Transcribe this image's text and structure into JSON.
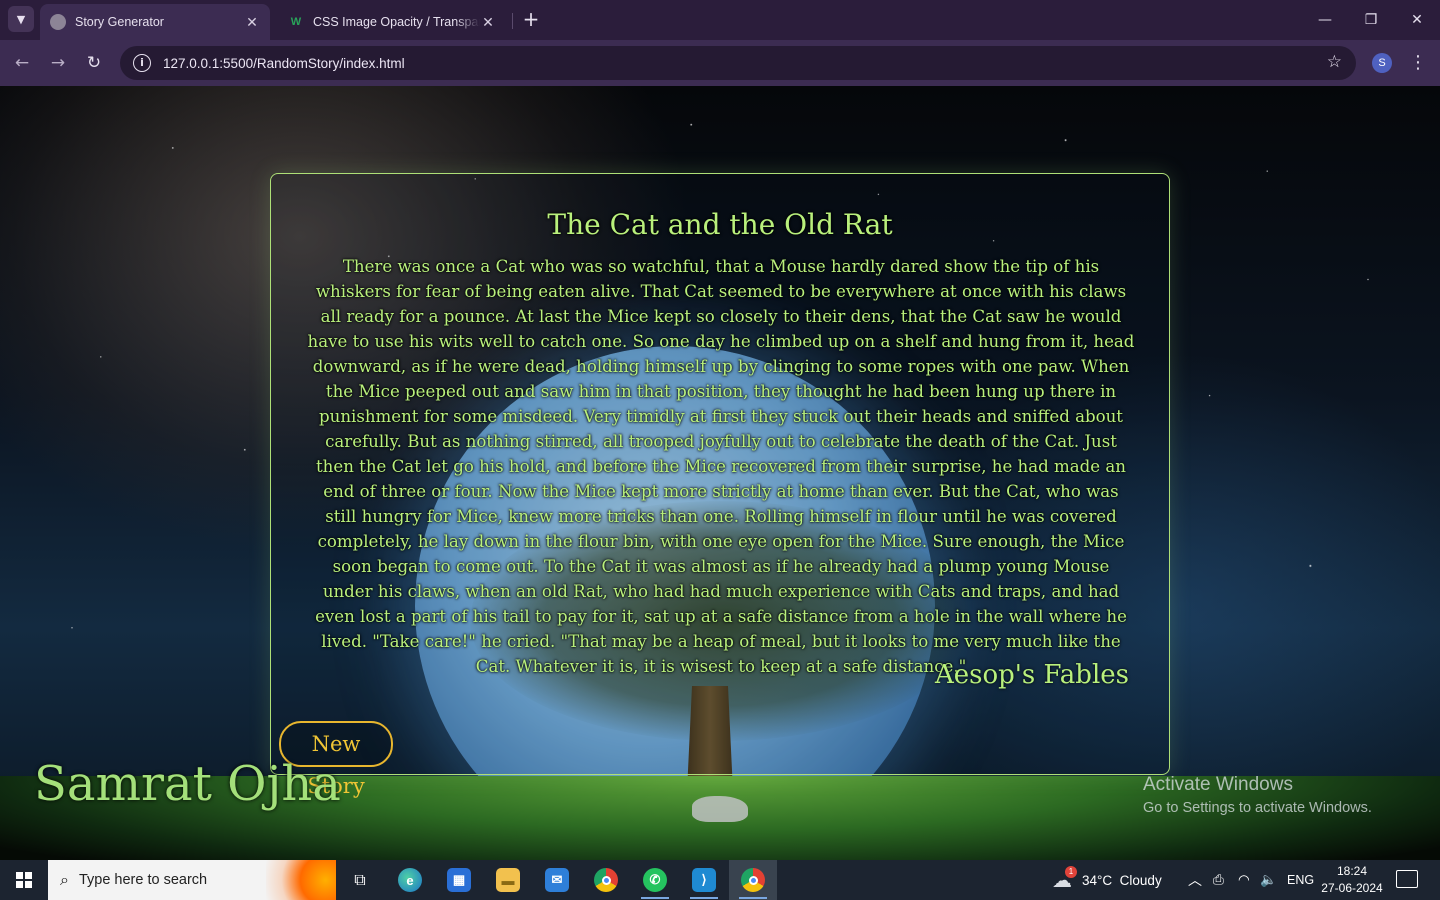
{
  "browser": {
    "tabs": [
      {
        "title": "Story Generator",
        "active": true
      },
      {
        "title": "CSS Image Opacity / Transparency",
        "active": false
      }
    ],
    "url": "127.0.0.1:5500/RandomStory/index.html",
    "profile_initial": "S"
  },
  "story": {
    "title": "The Cat and the Old Rat",
    "body": "There was once a Cat who was so watchful, that a Mouse hardly dared show the tip of his whiskers for fear of being eaten alive. That Cat seemed to be everywhere at once with his claws all ready for a pounce. At last the Mice kept so closely to their dens, that the Cat saw he would have to use his wits well to catch one. So one day he climbed up on a shelf and hung from it, head downward, as if he were dead, holding himself up by clinging to some ropes with one paw. When the Mice peeped out and saw him in that position, they thought he had been hung up there in punishment for some misdeed. Very timidly at first they stuck out their heads and sniffed about carefully. But as nothing stirred, all trooped joyfully out to celebrate the death of the Cat. Just then the Cat let go his hold, and before the Mice recovered from their surprise, he had made an end of three or four. Now the Mice kept more strictly at home than ever. But the Cat, who was still hungry for Mice, knew more tricks than one. Rolling himself in flour until he was covered completely, he lay down in the flour bin, with one eye open for the Mice. Sure enough, the Mice soon began to come out. To the Cat it was almost as if he already had a plump young Mouse under his claws, when an old Rat, who had had much experience with Cats and traps, and had even lost a part of his tail to pay for it, sat up at a safe distance from a hole in the wall where he lived. \"Take care!\" he cried. \"That may be a heap of meal, but it looks to me very much like the Cat. Whatever it is, it is wisest to keep at a safe distance.\"",
    "source": "Aesop's Fables",
    "button_label": "New Story",
    "author": "Samrat Ojha"
  },
  "watermark": {
    "line1": "Activate Windows",
    "line2": "Go to Settings to activate Windows."
  },
  "taskbar": {
    "search_placeholder": "Type here to search",
    "weather": "34°C  Cloudy",
    "weather_badge": "1",
    "language": "ENG",
    "time": "18:24",
    "date": "27-06-2024"
  },
  "colors": {
    "story_text": "#b9f07c",
    "button_border": "#e8b62e",
    "card_border": "#aee077"
  }
}
